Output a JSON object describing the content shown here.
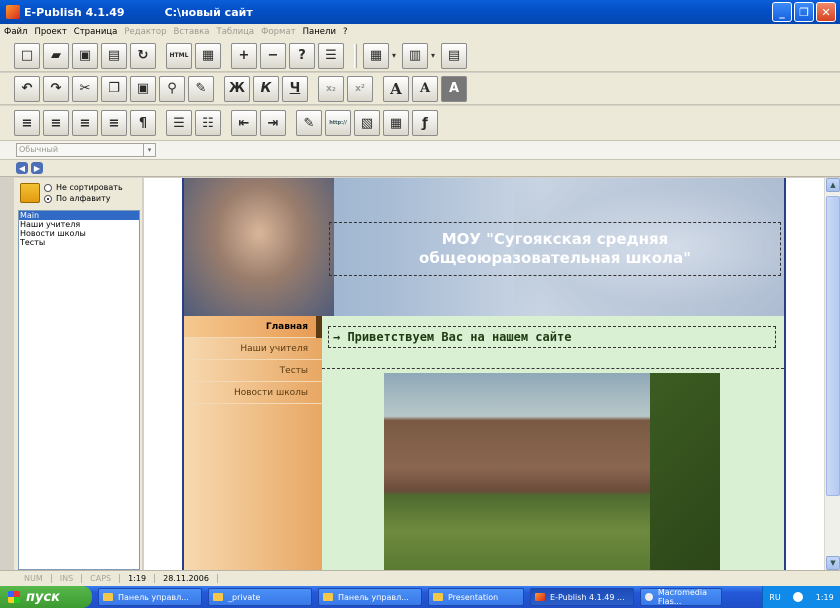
{
  "window": {
    "app_title": "E-Publish 4.1.49",
    "path": "C:\\новый сайт",
    "buttons": [
      "_",
      "❐",
      "✕"
    ]
  },
  "menu": [
    {
      "label": "Файл",
      "enabled": true
    },
    {
      "label": "Проект",
      "enabled": true
    },
    {
      "label": "Страница",
      "enabled": true
    },
    {
      "label": "Редактор",
      "enabled": false
    },
    {
      "label": "Вставка",
      "enabled": false
    },
    {
      "label": "Таблица",
      "enabled": false
    },
    {
      "label": "Формат",
      "enabled": false
    },
    {
      "label": "Панели",
      "enabled": true
    },
    {
      "label": "?",
      "enabled": true
    }
  ],
  "toolbar1": {
    "buttons": [
      "new-page",
      "open-folder",
      "save",
      "save-all",
      "refresh",
      "html",
      "view",
      "add",
      "remove",
      "help",
      "list"
    ],
    "html_label": "HTML"
  },
  "toolbar2": {
    "bold": "Ж",
    "italic": "К",
    "underline": "Ч",
    "sub": "x₂",
    "sup": "x²",
    "font1": "A",
    "font2": "A",
    "font3": "A"
  },
  "toolbar3": {
    "http_label": "http://"
  },
  "style_combo": {
    "value": "Обычный"
  },
  "left_panel": {
    "sort_options": [
      "Не сортировать",
      "По алфавиту"
    ],
    "selected_sort": 1,
    "pages": [
      {
        "label": "Main",
        "selected": true
      },
      {
        "label": "Наши учителя",
        "selected": false
      },
      {
        "label": "Новости школы",
        "selected": false
      },
      {
        "label": "Тесты",
        "selected": false
      }
    ]
  },
  "site": {
    "header_title_line1": "МОУ \"Сугоякская средняя",
    "header_title_line2": "общеоюразовательная школа\"",
    "nav": [
      {
        "label": "Главная",
        "active": true
      },
      {
        "label": "Наши учителя",
        "active": false
      },
      {
        "label": "Тесты",
        "active": false
      },
      {
        "label": "Новости школы",
        "active": false
      }
    ],
    "welcome": "→ Приветствуем Вас на нашем сайте"
  },
  "status": {
    "num": "NUM",
    "ins": "INS",
    "caps": "CAPS",
    "pos": "1:19",
    "date": "28.11.2006"
  },
  "taskbar": {
    "start": "пуск",
    "tasks": [
      {
        "label": "Панель управл...",
        "icon": "folder",
        "active": false
      },
      {
        "label": "_private",
        "icon": "folder",
        "active": false
      },
      {
        "label": "Панель управл...",
        "icon": "folder",
        "active": false
      },
      {
        "label": "Presentation",
        "icon": "folder",
        "active": false
      },
      {
        "label": "E-Publish 4.1.49 ...",
        "icon": "epublish",
        "active": true
      },
      {
        "label": "Macromedia Flas...",
        "icon": "macromedia",
        "active": false
      }
    ],
    "lang": "RU",
    "clock": "1:19"
  }
}
